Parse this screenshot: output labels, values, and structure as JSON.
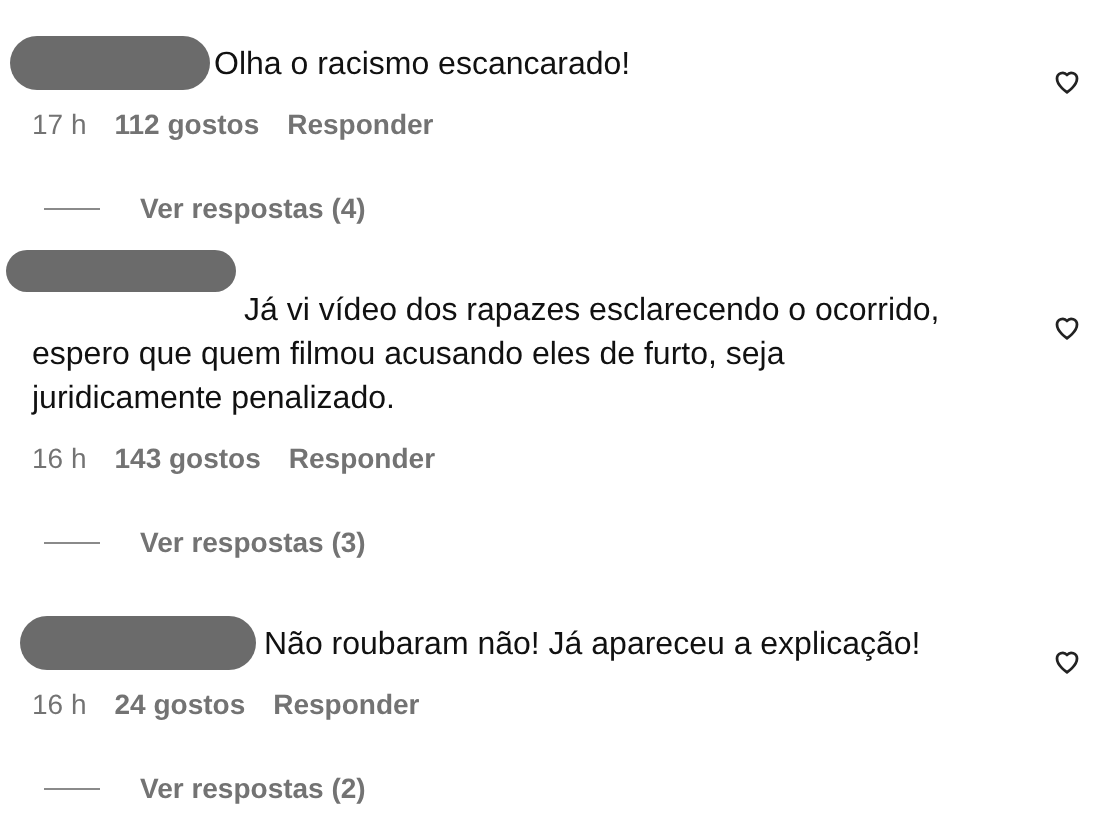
{
  "comments": [
    {
      "text": "Olha o racismo escancarado!",
      "time": "17 h",
      "likes": "112 gostos",
      "reply": "Responder",
      "view_replies": "Ver respostas (4)"
    },
    {
      "text": "Já vi vídeo dos rapazes esclarecendo o ocorrido, espero que quem filmou acusando eles de furto, seja juridicamente penalizado.",
      "time": "16 h",
      "likes": "143 gostos",
      "reply": "Responder",
      "view_replies": "Ver respostas (3)"
    },
    {
      "text": "Não roubaram não! Já apareceu a explicação!",
      "time": "16 h",
      "likes": "24 gostos",
      "reply": "Responder",
      "view_replies": "Ver respostas (2)"
    }
  ]
}
